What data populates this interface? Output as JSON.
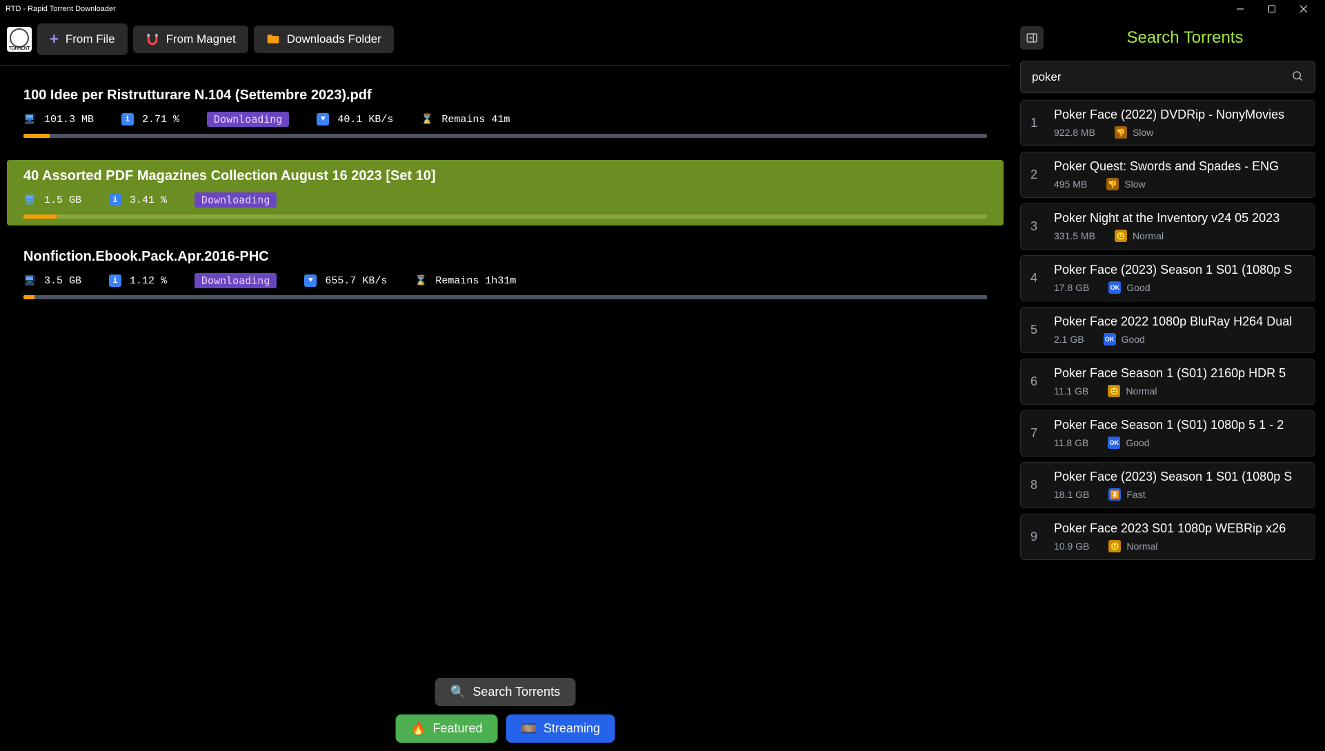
{
  "app": {
    "window_title": "RTD - Rapid Torrent Downloader",
    "logo_text": "TORRENT"
  },
  "toolbar": {
    "from_file": "From File",
    "from_magnet": "From Magnet",
    "downloads_folder": "Downloads Folder"
  },
  "downloads": [
    {
      "title": "100 Idee per Ristrutturare N.104 (Settembre 2023).pdf",
      "size": "101.3 MB",
      "percent": "2.71 %",
      "status": "Downloading",
      "speed": "40.1 KB/s",
      "remaining": "Remains 41m",
      "progress_pct": "2.71",
      "selected": false,
      "show_speed": true
    },
    {
      "title": "40 Assorted PDF Magazines Collection August 16 2023 [Set 10]",
      "size": "1.5 GB",
      "percent": "3.41 %",
      "status": "Downloading",
      "speed": "",
      "remaining": "",
      "progress_pct": "3.41",
      "selected": true,
      "show_speed": false
    },
    {
      "title": "Nonfiction.Ebook.Pack.Apr.2016-PHC",
      "size": "3.5 GB",
      "percent": "1.12 %",
      "status": "Downloading",
      "speed": "655.7 KB/s",
      "remaining": "Remains 1h31m",
      "progress_pct": "1.12",
      "selected": false,
      "show_speed": true
    }
  ],
  "bottom_buttons": {
    "search": "Search Torrents",
    "featured": "Featured",
    "streaming": "Streaming"
  },
  "search_panel": {
    "title": "Search Torrents",
    "query": "poker",
    "placeholder": "",
    "results": [
      {
        "n": "1",
        "title": "Poker Face (2022) DVDRip - NonyMovies",
        "size": "922.8 MB",
        "speed": "Slow",
        "speed_class": "sb-slow",
        "speed_icon": "👎"
      },
      {
        "n": "2",
        "title": "Poker Quest: Swords and Spades - ENG",
        "size": "495 MB",
        "speed": "Slow",
        "speed_class": "sb-slow",
        "speed_icon": "👎"
      },
      {
        "n": "3",
        "title": "Poker Night at the Inventory v24 05 2023",
        "size": "331.5 MB",
        "speed": "Normal",
        "speed_class": "sb-normal",
        "speed_icon": "😐"
      },
      {
        "n": "4",
        "title": "Poker Face (2023) Season 1 S01 (1080p S",
        "size": "17.8 GB",
        "speed": "Good",
        "speed_class": "sb-good",
        "speed_icon": "OK"
      },
      {
        "n": "5",
        "title": "Poker Face 2022 1080p BluRay H264 Dual",
        "size": "2.1 GB",
        "speed": "Good",
        "speed_class": "sb-good",
        "speed_icon": "OK"
      },
      {
        "n": "6",
        "title": "Poker Face Season 1 (S01) 2160p HDR 5",
        "size": "11.1 GB",
        "speed": "Normal",
        "speed_class": "sb-normal",
        "speed_icon": "😐"
      },
      {
        "n": "7",
        "title": "Poker Face Season 1 (S01) 1080p 5 1 - 2",
        "size": "11.8 GB",
        "speed": "Good",
        "speed_class": "sb-good",
        "speed_icon": "OK"
      },
      {
        "n": "8",
        "title": "Poker Face (2023) Season 1 S01 (1080p S",
        "size": "18.1 GB",
        "speed": "Fast",
        "speed_class": "sb-fast",
        "speed_icon": "⏬"
      },
      {
        "n": "9",
        "title": "Poker Face 2023 S01 1080p WEBRip x26",
        "size": "10.9 GB",
        "speed": "Normal",
        "speed_class": "sb-normal",
        "speed_icon": "😐"
      }
    ]
  }
}
